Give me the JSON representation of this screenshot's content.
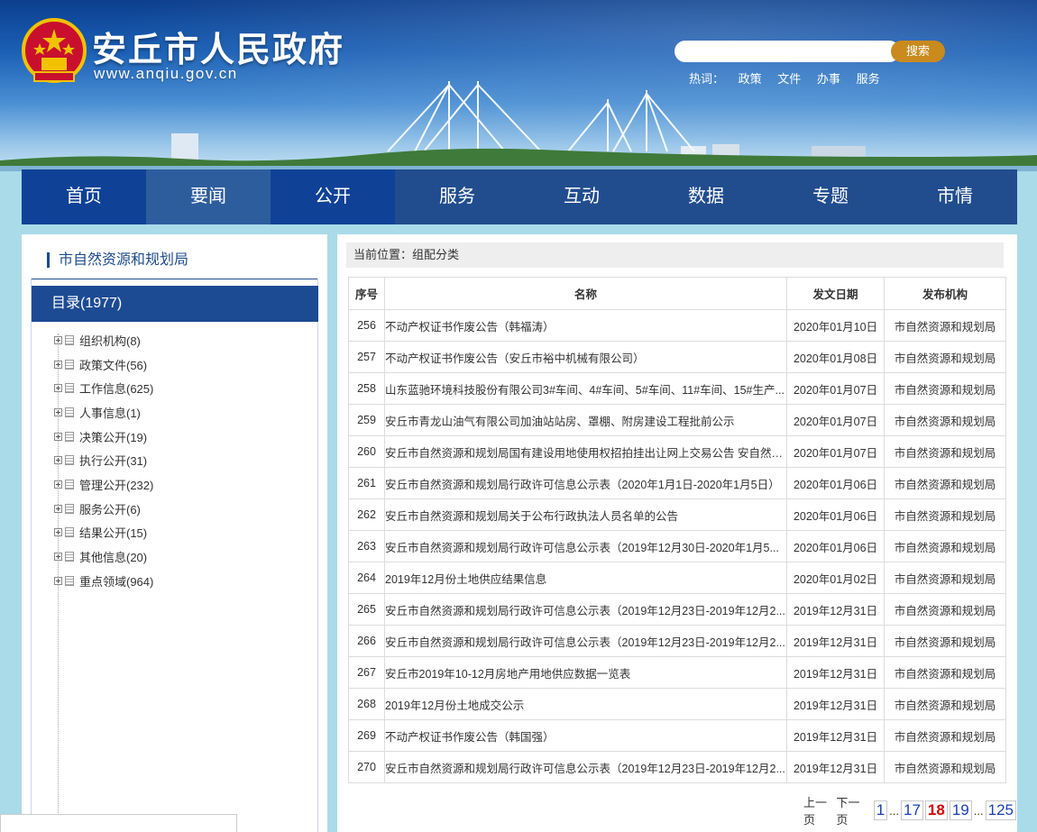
{
  "header": {
    "site_title": "安丘市人民政府",
    "site_url": "www.anqiu.gov.cn",
    "search_placeholder": "",
    "search_button": "搜索",
    "hot_label": "热词：",
    "hot_words": [
      "政策",
      "文件",
      "办事",
      "服务"
    ]
  },
  "nav": [
    "首页",
    "要闻",
    "公开",
    "服务",
    "互动",
    "数据",
    "专题",
    "市情"
  ],
  "sidebar": {
    "title": "市自然资源和规划局",
    "catalog": "目录(1977)",
    "items": [
      "组织机构(8)",
      "政策文件(56)",
      "工作信息(625)",
      "人事信息(1)",
      "决策公开(19)",
      "执行公开(31)",
      "管理公开(232)",
      "服务公开(6)",
      "结果公开(15)",
      "其他信息(20)",
      "重点领域(964)"
    ]
  },
  "breadcrumb": "当前位置：组配分类",
  "table": {
    "headers": [
      "序号",
      "名称",
      "发文日期",
      "发布机构"
    ],
    "rows": [
      [
        "256",
        "不动产权证书作废公告（韩福涛）",
        "2020年01月10日",
        "市自然资源和规划局"
      ],
      [
        "257",
        "不动产权证书作废公告（安丘市裕中机械有限公司）",
        "2020年01月08日",
        "市自然资源和规划局"
      ],
      [
        "258",
        "山东蓝驰环境科技股份有限公司3#车间、4#车间、5#车间、11#车间、15#生产...",
        "2020年01月07日",
        "市自然资源和规划局"
      ],
      [
        "259",
        "安丘市青龙山油气有限公司加油站站房、罩棚、附房建设工程批前公示",
        "2020年01月07日",
        "市自然资源和规划局"
      ],
      [
        "260",
        "安丘市自然资源和规划局国有建设用地使用权招拍挂出让网上交易公告 安自然资...",
        "2020年01月07日",
        "市自然资源和规划局"
      ],
      [
        "261",
        "安丘市自然资源和规划局行政许可信息公示表（2020年1月1日-2020年1月5日）",
        "2020年01月06日",
        "市自然资源和规划局"
      ],
      [
        "262",
        "安丘市自然资源和规划局关于公布行政执法人员名单的公告",
        "2020年01月06日",
        "市自然资源和规划局"
      ],
      [
        "263",
        "安丘市自然资源和规划局行政许可信息公示表（2019年12月30日-2020年1月5...",
        "2020年01月06日",
        "市自然资源和规划局"
      ],
      [
        "264",
        "2019年12月份土地供应结果信息",
        "2020年01月02日",
        "市自然资源和规划局"
      ],
      [
        "265",
        "安丘市自然资源和规划局行政许可信息公示表（2019年12月23日-2019年12月2...",
        "2019年12月31日",
        "市自然资源和规划局"
      ],
      [
        "266",
        "安丘市自然资源和规划局行政许可信息公示表（2019年12月23日-2019年12月2...",
        "2019年12月31日",
        "市自然资源和规划局"
      ],
      [
        "267",
        "安丘市2019年10-12月房地产用地供应数据一览表",
        "2019年12月31日",
        "市自然资源和规划局"
      ],
      [
        "268",
        "2019年12月份土地成交公示",
        "2019年12月31日",
        "市自然资源和规划局"
      ],
      [
        "269",
        "不动产权证书作废公告（韩国强）",
        "2019年12月31日",
        "市自然资源和规划局"
      ],
      [
        "270",
        "安丘市自然资源和规划局行政许可信息公示表（2019年12月23日-2019年12月2...",
        "2019年12月31日",
        "市自然资源和规划局"
      ]
    ]
  },
  "pager": {
    "prev": "上一页",
    "next": "下一页",
    "first": "1",
    "ellipsis": "...",
    "pages": [
      "17",
      "18",
      "19"
    ],
    "current": "18",
    "last": "125"
  },
  "colors": {
    "nav_bg": "#214d8e",
    "nav_active": "#0f4296",
    "catalog_bg": "#1c4b93",
    "search_button": "#c98a1e",
    "current_page": "#d40000"
  }
}
